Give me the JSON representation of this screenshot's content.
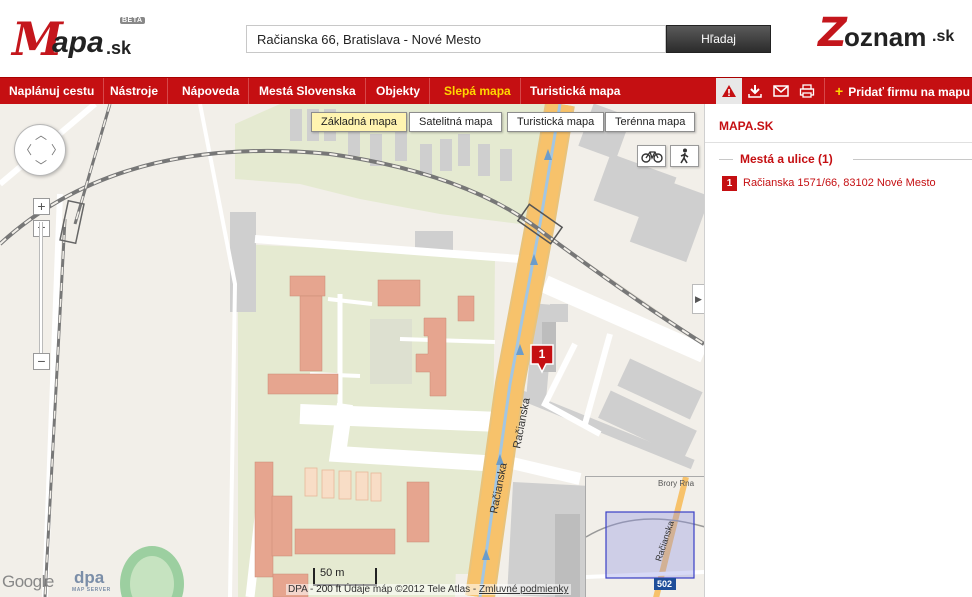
{
  "logo": {
    "letter": "M",
    "text": "apa",
    "suffix": ".sk",
    "badge": "BETA"
  },
  "partner_logo": {
    "letter": "Z",
    "text": "oznam",
    "suffix": ".sk"
  },
  "search": {
    "value": "Račianska 66, Bratislava - Nové Mesto",
    "button_label": "Hľadaj"
  },
  "nav": {
    "items": [
      {
        "label": "Naplánuj cestu"
      },
      {
        "label": "Nástroje"
      },
      {
        "label": "Nápoveda"
      },
      {
        "label": "Mestá Slovenska"
      },
      {
        "label": "Objekty"
      },
      {
        "label": "Slepá mapa",
        "active": true
      },
      {
        "label": "Turistická mapa"
      }
    ],
    "tools": [
      "warning-icon",
      "download-icon",
      "mail-icon",
      "print-icon"
    ],
    "add_firm_label": "Pridať firmu na mapu"
  },
  "map": {
    "types": [
      {
        "label": "Základná mapa",
        "active": true
      },
      {
        "label": "Satelitná mapa"
      },
      {
        "label": "Turistická mapa"
      },
      {
        "label": "Terénna mapa"
      }
    ],
    "layers": [
      "bicycle-icon",
      "pedestrian-icon"
    ],
    "street_labels": [
      "Račianska",
      "Račianska"
    ],
    "marker_label": "1",
    "scale": {
      "top": "50 m",
      "bottom": "200 ft"
    },
    "copyright": {
      "prefix": "DPA -",
      "text": "Údaje máp ©2012 Tele Atlas -",
      "link": "Zmluvné podmienky"
    },
    "google": "Google",
    "dpa": {
      "text": "dpa",
      "sub": "MAP SERVER"
    },
    "overview": {
      "street": "Račianska",
      "road_number": "502",
      "top_text": "Brory Rna"
    }
  },
  "sidebar": {
    "title": "MAPA.SK",
    "results_heading": "Mestá a ulice (1)",
    "results": [
      {
        "num": "1",
        "text": "Račianska 1571/66, 83102 Nové Mesto"
      }
    ]
  },
  "colors": {
    "brand_red": "#c50f12",
    "active_nav": "#ffd800",
    "road_orange": "#f7c26b",
    "park_green": "#e5ead1",
    "building": "#e6a58f"
  }
}
